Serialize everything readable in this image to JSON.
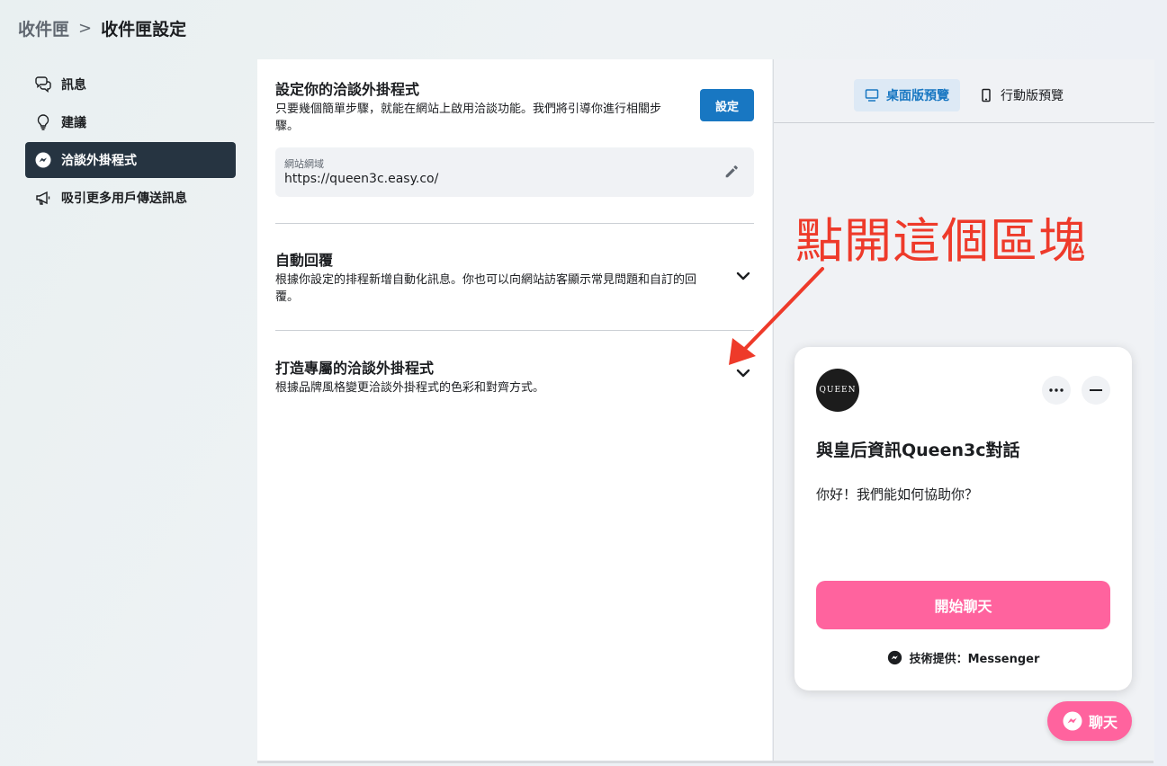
{
  "breadcrumb": {
    "parent": "收件匣",
    "separator": ">",
    "current": "收件匣設定"
  },
  "sidebar": {
    "items": [
      {
        "label": "訊息",
        "icon": "chat-bubbles-icon"
      },
      {
        "label": "建議",
        "icon": "lightbulb-icon"
      },
      {
        "label": "洽談外掛程式",
        "icon": "messenger-icon",
        "active": true
      },
      {
        "label": "吸引更多用戶傳送訊息",
        "icon": "megaphone-icon"
      }
    ]
  },
  "setup": {
    "title": "設定你的洽談外掛程式",
    "description": "只要幾個簡單步驟，就能在網站上啟用洽談功能。我們將引導你進行相關步驟。",
    "button": "設定",
    "domain_label": "網站網域",
    "domain_value": "https://queen3c.easy.co/"
  },
  "auto_reply": {
    "title": "自動回覆",
    "description": "根據你設定的排程新增自動化訊息。你也可以向網站訪客顯示常見問題和自訂的回覆。"
  },
  "customize": {
    "title": "打造專屬的洽談外掛程式",
    "description": "根據品牌風格變更洽談外掛程式的色彩和對齊方式。"
  },
  "preview": {
    "tabs": [
      {
        "label": "桌面版預覽",
        "icon": "desktop-icon",
        "active": true
      },
      {
        "label": "行動版預覽",
        "icon": "mobile-icon",
        "active": false
      }
    ]
  },
  "annotation": {
    "text": "點開這個區塊",
    "color": "#ee3a2a"
  },
  "chat_widget": {
    "avatar_text": "QUEEN",
    "title": "與皇后資訊Queen3c對話",
    "greeting": "你好！我們能如何協助你？",
    "start_button": "開始聊天",
    "powered_by": "技術提供：Messenger",
    "accent_color": "#ff639e"
  },
  "chat_fab": {
    "label": "聊天"
  },
  "colors": {
    "primary": "#1877c2",
    "sidebar_active": "#263441"
  }
}
